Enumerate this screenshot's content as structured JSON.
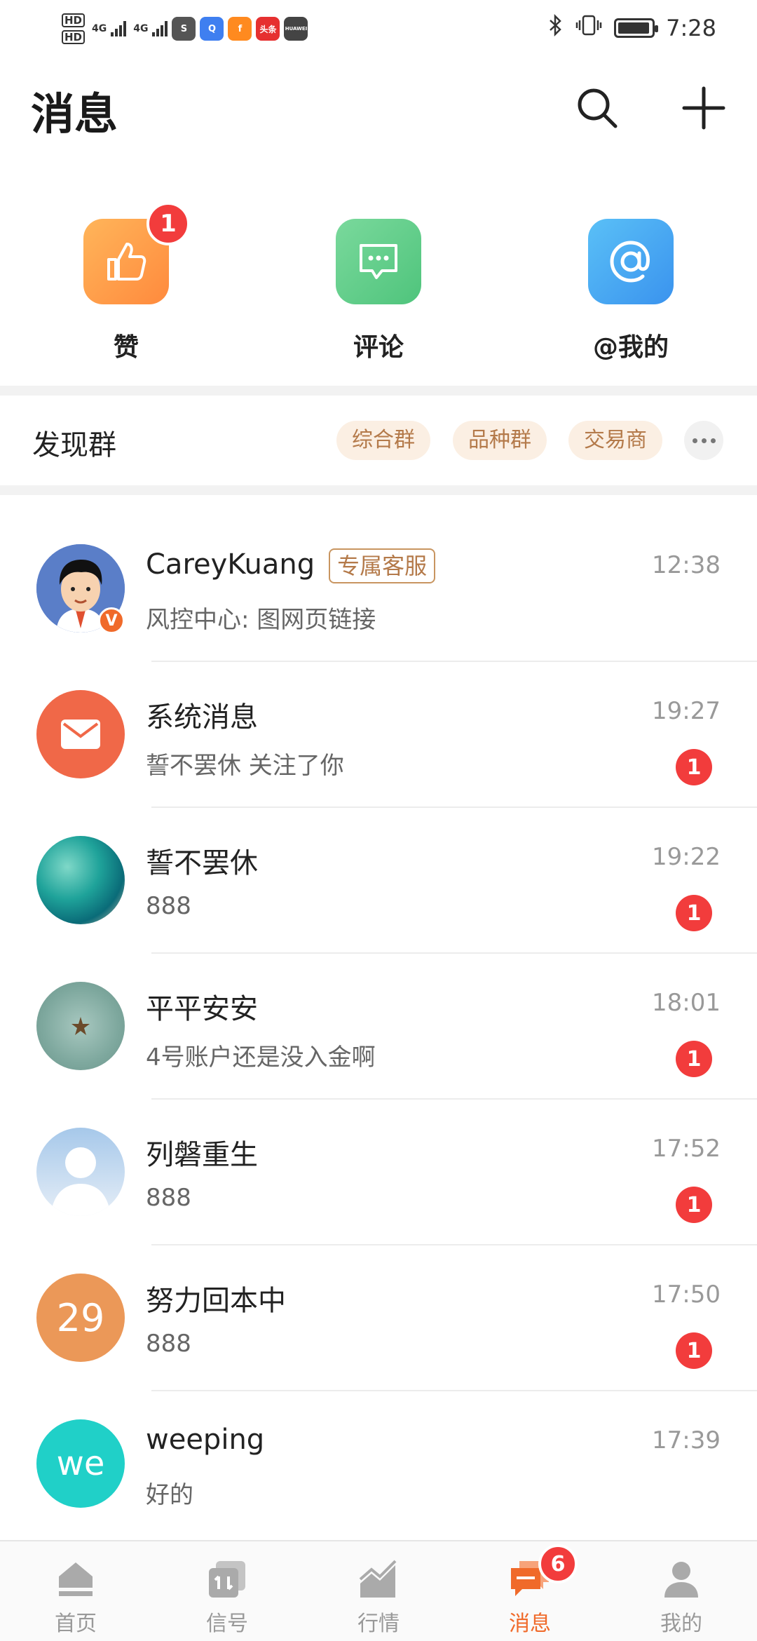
{
  "status_bar": {
    "hd1": "HD",
    "hd2": "HD",
    "net1": "4G",
    "net2": "4G",
    "app_icons": [
      "sina",
      "browser",
      "finance",
      "头条",
      "HUAWEI"
    ],
    "time": "7:28"
  },
  "header": {
    "title": "消息"
  },
  "quick_actions": [
    {
      "label": "赞",
      "badge": "1",
      "icon": "thumbs-up-icon",
      "color": "#ff9c4a"
    },
    {
      "label": "评论",
      "icon": "comment-icon",
      "color": "#5ecf8a"
    },
    {
      "label": "@我的",
      "icon": "at-icon",
      "color": "#4aa8f0"
    }
  ],
  "discover": {
    "title": "发现群",
    "chips": [
      "综合群",
      "品种群",
      "交易商"
    ]
  },
  "messages": [
    {
      "name": "CareyKuang",
      "tag": "专属客服",
      "text": "风控中心: 图网页链接",
      "time": "12:38",
      "unread": ""
    },
    {
      "name": "系统消息",
      "tag": "",
      "text": "誓不罢休 关注了你",
      "time": "19:27",
      "unread": "1"
    },
    {
      "name": "誓不罢休",
      "tag": "",
      "text": "888",
      "time": "19:22",
      "unread": "1"
    },
    {
      "name": "平平安安",
      "tag": "",
      "text": "4号账户还是没入金啊",
      "time": "18:01",
      "unread": "1"
    },
    {
      "name": "列磐重生",
      "tag": "",
      "text": "888",
      "time": "17:52",
      "unread": "1"
    },
    {
      "name": "努力回本中",
      "tag": "",
      "text": "888",
      "time": "17:50",
      "unread": "1",
      "avatar_text": "29"
    },
    {
      "name": "weeping",
      "tag": "",
      "text": "好的",
      "time": "17:39",
      "unread": "",
      "avatar_text": "we"
    }
  ],
  "bottom_nav": [
    {
      "label": "首页",
      "icon": "home-icon"
    },
    {
      "label": "信号",
      "icon": "signal-icon"
    },
    {
      "label": "行情",
      "icon": "market-icon"
    },
    {
      "label": "消息",
      "icon": "message-icon",
      "badge": "6",
      "active": true
    },
    {
      "label": "我的",
      "icon": "profile-icon"
    }
  ],
  "colors": {
    "accent": "#f06a2a",
    "badge": "#f23c3c",
    "chip_bg": "#fbefe3",
    "chip_text": "#b47a4a"
  }
}
